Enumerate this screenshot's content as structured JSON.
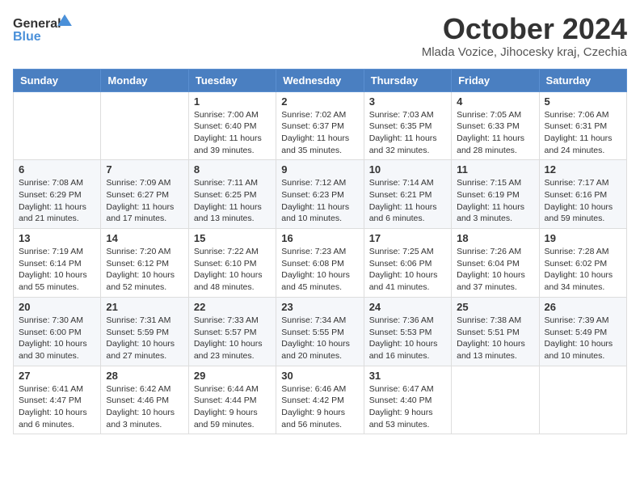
{
  "header": {
    "logo_general": "General",
    "logo_blue": "Blue",
    "month_title": "October 2024",
    "location": "Mlada Vozice, Jihocesky kraj, Czechia"
  },
  "weekdays": [
    "Sunday",
    "Monday",
    "Tuesday",
    "Wednesday",
    "Thursday",
    "Friday",
    "Saturday"
  ],
  "weeks": [
    [
      {
        "day": "",
        "info": ""
      },
      {
        "day": "",
        "info": ""
      },
      {
        "day": "1",
        "info": "Sunrise: 7:00 AM\nSunset: 6:40 PM\nDaylight: 11 hours and 39 minutes."
      },
      {
        "day": "2",
        "info": "Sunrise: 7:02 AM\nSunset: 6:37 PM\nDaylight: 11 hours and 35 minutes."
      },
      {
        "day": "3",
        "info": "Sunrise: 7:03 AM\nSunset: 6:35 PM\nDaylight: 11 hours and 32 minutes."
      },
      {
        "day": "4",
        "info": "Sunrise: 7:05 AM\nSunset: 6:33 PM\nDaylight: 11 hours and 28 minutes."
      },
      {
        "day": "5",
        "info": "Sunrise: 7:06 AM\nSunset: 6:31 PM\nDaylight: 11 hours and 24 minutes."
      }
    ],
    [
      {
        "day": "6",
        "info": "Sunrise: 7:08 AM\nSunset: 6:29 PM\nDaylight: 11 hours and 21 minutes."
      },
      {
        "day": "7",
        "info": "Sunrise: 7:09 AM\nSunset: 6:27 PM\nDaylight: 11 hours and 17 minutes."
      },
      {
        "day": "8",
        "info": "Sunrise: 7:11 AM\nSunset: 6:25 PM\nDaylight: 11 hours and 13 minutes."
      },
      {
        "day": "9",
        "info": "Sunrise: 7:12 AM\nSunset: 6:23 PM\nDaylight: 11 hours and 10 minutes."
      },
      {
        "day": "10",
        "info": "Sunrise: 7:14 AM\nSunset: 6:21 PM\nDaylight: 11 hours and 6 minutes."
      },
      {
        "day": "11",
        "info": "Sunrise: 7:15 AM\nSunset: 6:19 PM\nDaylight: 11 hours and 3 minutes."
      },
      {
        "day": "12",
        "info": "Sunrise: 7:17 AM\nSunset: 6:16 PM\nDaylight: 10 hours and 59 minutes."
      }
    ],
    [
      {
        "day": "13",
        "info": "Sunrise: 7:19 AM\nSunset: 6:14 PM\nDaylight: 10 hours and 55 minutes."
      },
      {
        "day": "14",
        "info": "Sunrise: 7:20 AM\nSunset: 6:12 PM\nDaylight: 10 hours and 52 minutes."
      },
      {
        "day": "15",
        "info": "Sunrise: 7:22 AM\nSunset: 6:10 PM\nDaylight: 10 hours and 48 minutes."
      },
      {
        "day": "16",
        "info": "Sunrise: 7:23 AM\nSunset: 6:08 PM\nDaylight: 10 hours and 45 minutes."
      },
      {
        "day": "17",
        "info": "Sunrise: 7:25 AM\nSunset: 6:06 PM\nDaylight: 10 hours and 41 minutes."
      },
      {
        "day": "18",
        "info": "Sunrise: 7:26 AM\nSunset: 6:04 PM\nDaylight: 10 hours and 37 minutes."
      },
      {
        "day": "19",
        "info": "Sunrise: 7:28 AM\nSunset: 6:02 PM\nDaylight: 10 hours and 34 minutes."
      }
    ],
    [
      {
        "day": "20",
        "info": "Sunrise: 7:30 AM\nSunset: 6:00 PM\nDaylight: 10 hours and 30 minutes."
      },
      {
        "day": "21",
        "info": "Sunrise: 7:31 AM\nSunset: 5:59 PM\nDaylight: 10 hours and 27 minutes."
      },
      {
        "day": "22",
        "info": "Sunrise: 7:33 AM\nSunset: 5:57 PM\nDaylight: 10 hours and 23 minutes."
      },
      {
        "day": "23",
        "info": "Sunrise: 7:34 AM\nSunset: 5:55 PM\nDaylight: 10 hours and 20 minutes."
      },
      {
        "day": "24",
        "info": "Sunrise: 7:36 AM\nSunset: 5:53 PM\nDaylight: 10 hours and 16 minutes."
      },
      {
        "day": "25",
        "info": "Sunrise: 7:38 AM\nSunset: 5:51 PM\nDaylight: 10 hours and 13 minutes."
      },
      {
        "day": "26",
        "info": "Sunrise: 7:39 AM\nSunset: 5:49 PM\nDaylight: 10 hours and 10 minutes."
      }
    ],
    [
      {
        "day": "27",
        "info": "Sunrise: 6:41 AM\nSunset: 4:47 PM\nDaylight: 10 hours and 6 minutes."
      },
      {
        "day": "28",
        "info": "Sunrise: 6:42 AM\nSunset: 4:46 PM\nDaylight: 10 hours and 3 minutes."
      },
      {
        "day": "29",
        "info": "Sunrise: 6:44 AM\nSunset: 4:44 PM\nDaylight: 9 hours and 59 minutes."
      },
      {
        "day": "30",
        "info": "Sunrise: 6:46 AM\nSunset: 4:42 PM\nDaylight: 9 hours and 56 minutes."
      },
      {
        "day": "31",
        "info": "Sunrise: 6:47 AM\nSunset: 4:40 PM\nDaylight: 9 hours and 53 minutes."
      },
      {
        "day": "",
        "info": ""
      },
      {
        "day": "",
        "info": ""
      }
    ]
  ]
}
